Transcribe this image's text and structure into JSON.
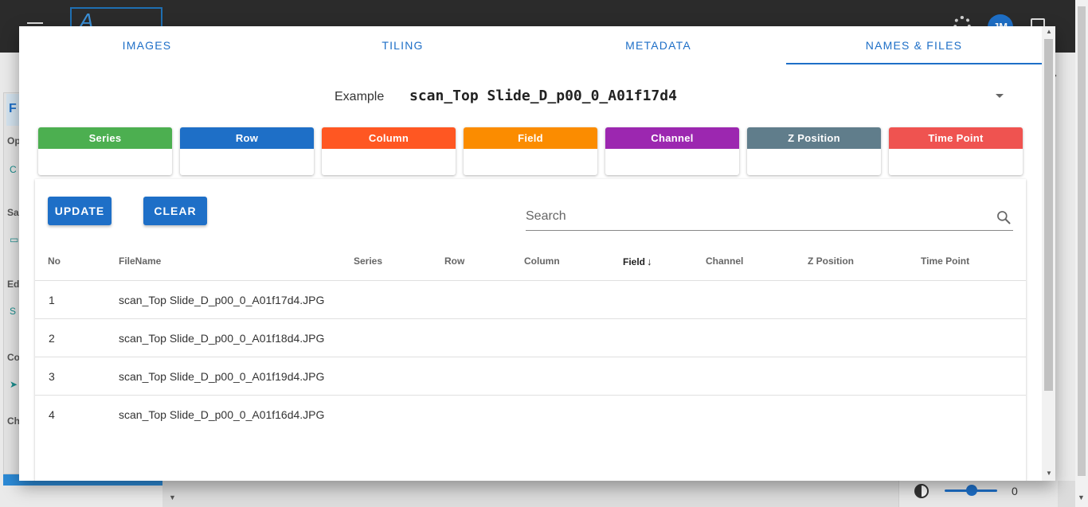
{
  "app": {
    "avatar_initials": "JM",
    "slider_value": "0"
  },
  "dialog": {
    "tabs": [
      {
        "label": "IMAGES"
      },
      {
        "label": "TILING"
      },
      {
        "label": "METADATA"
      },
      {
        "label": "NAMES & FILES",
        "active": true
      }
    ],
    "example": {
      "label": "Example",
      "value": "scan_Top Slide_D_p00_0_A01f17d4"
    },
    "chips": [
      {
        "label": "Series",
        "color": "#4caf50",
        "value": ""
      },
      {
        "label": "Row",
        "color": "#1e6fc7",
        "value": ""
      },
      {
        "label": "Column",
        "color": "#ff5722",
        "value": ""
      },
      {
        "label": "Field",
        "color": "#fb8c00",
        "value": ""
      },
      {
        "label": "Channel",
        "color": "#9c27b0",
        "value": ""
      },
      {
        "label": "Z Position",
        "color": "#607d8b",
        "value": ""
      },
      {
        "label": "Time Point",
        "color": "#ef5350",
        "value": ""
      }
    ],
    "buttons": {
      "update": "UPDATE",
      "clear": "CLEAR"
    },
    "search": {
      "placeholder": "Search",
      "value": ""
    },
    "table": {
      "headers": [
        "No",
        "FileName",
        "Series",
        "Row",
        "Column",
        "Field",
        "Channel",
        "Z Position",
        "Time Point"
      ],
      "sorted_by": "Field",
      "sort_arrow": "↓",
      "rows": [
        {
          "no": "1",
          "filename": "scan_Top Slide_D_p00_0_A01f17d4.JPG"
        },
        {
          "no": "2",
          "filename": "scan_Top Slide_D_p00_0_A01f18d4.JPG"
        },
        {
          "no": "3",
          "filename": "scan_Top Slide_D_p00_0_A01f19d4.JPG"
        },
        {
          "no": "4",
          "filename": "scan_Top Slide_D_p00_0_A01f16d4.JPG"
        }
      ]
    }
  }
}
